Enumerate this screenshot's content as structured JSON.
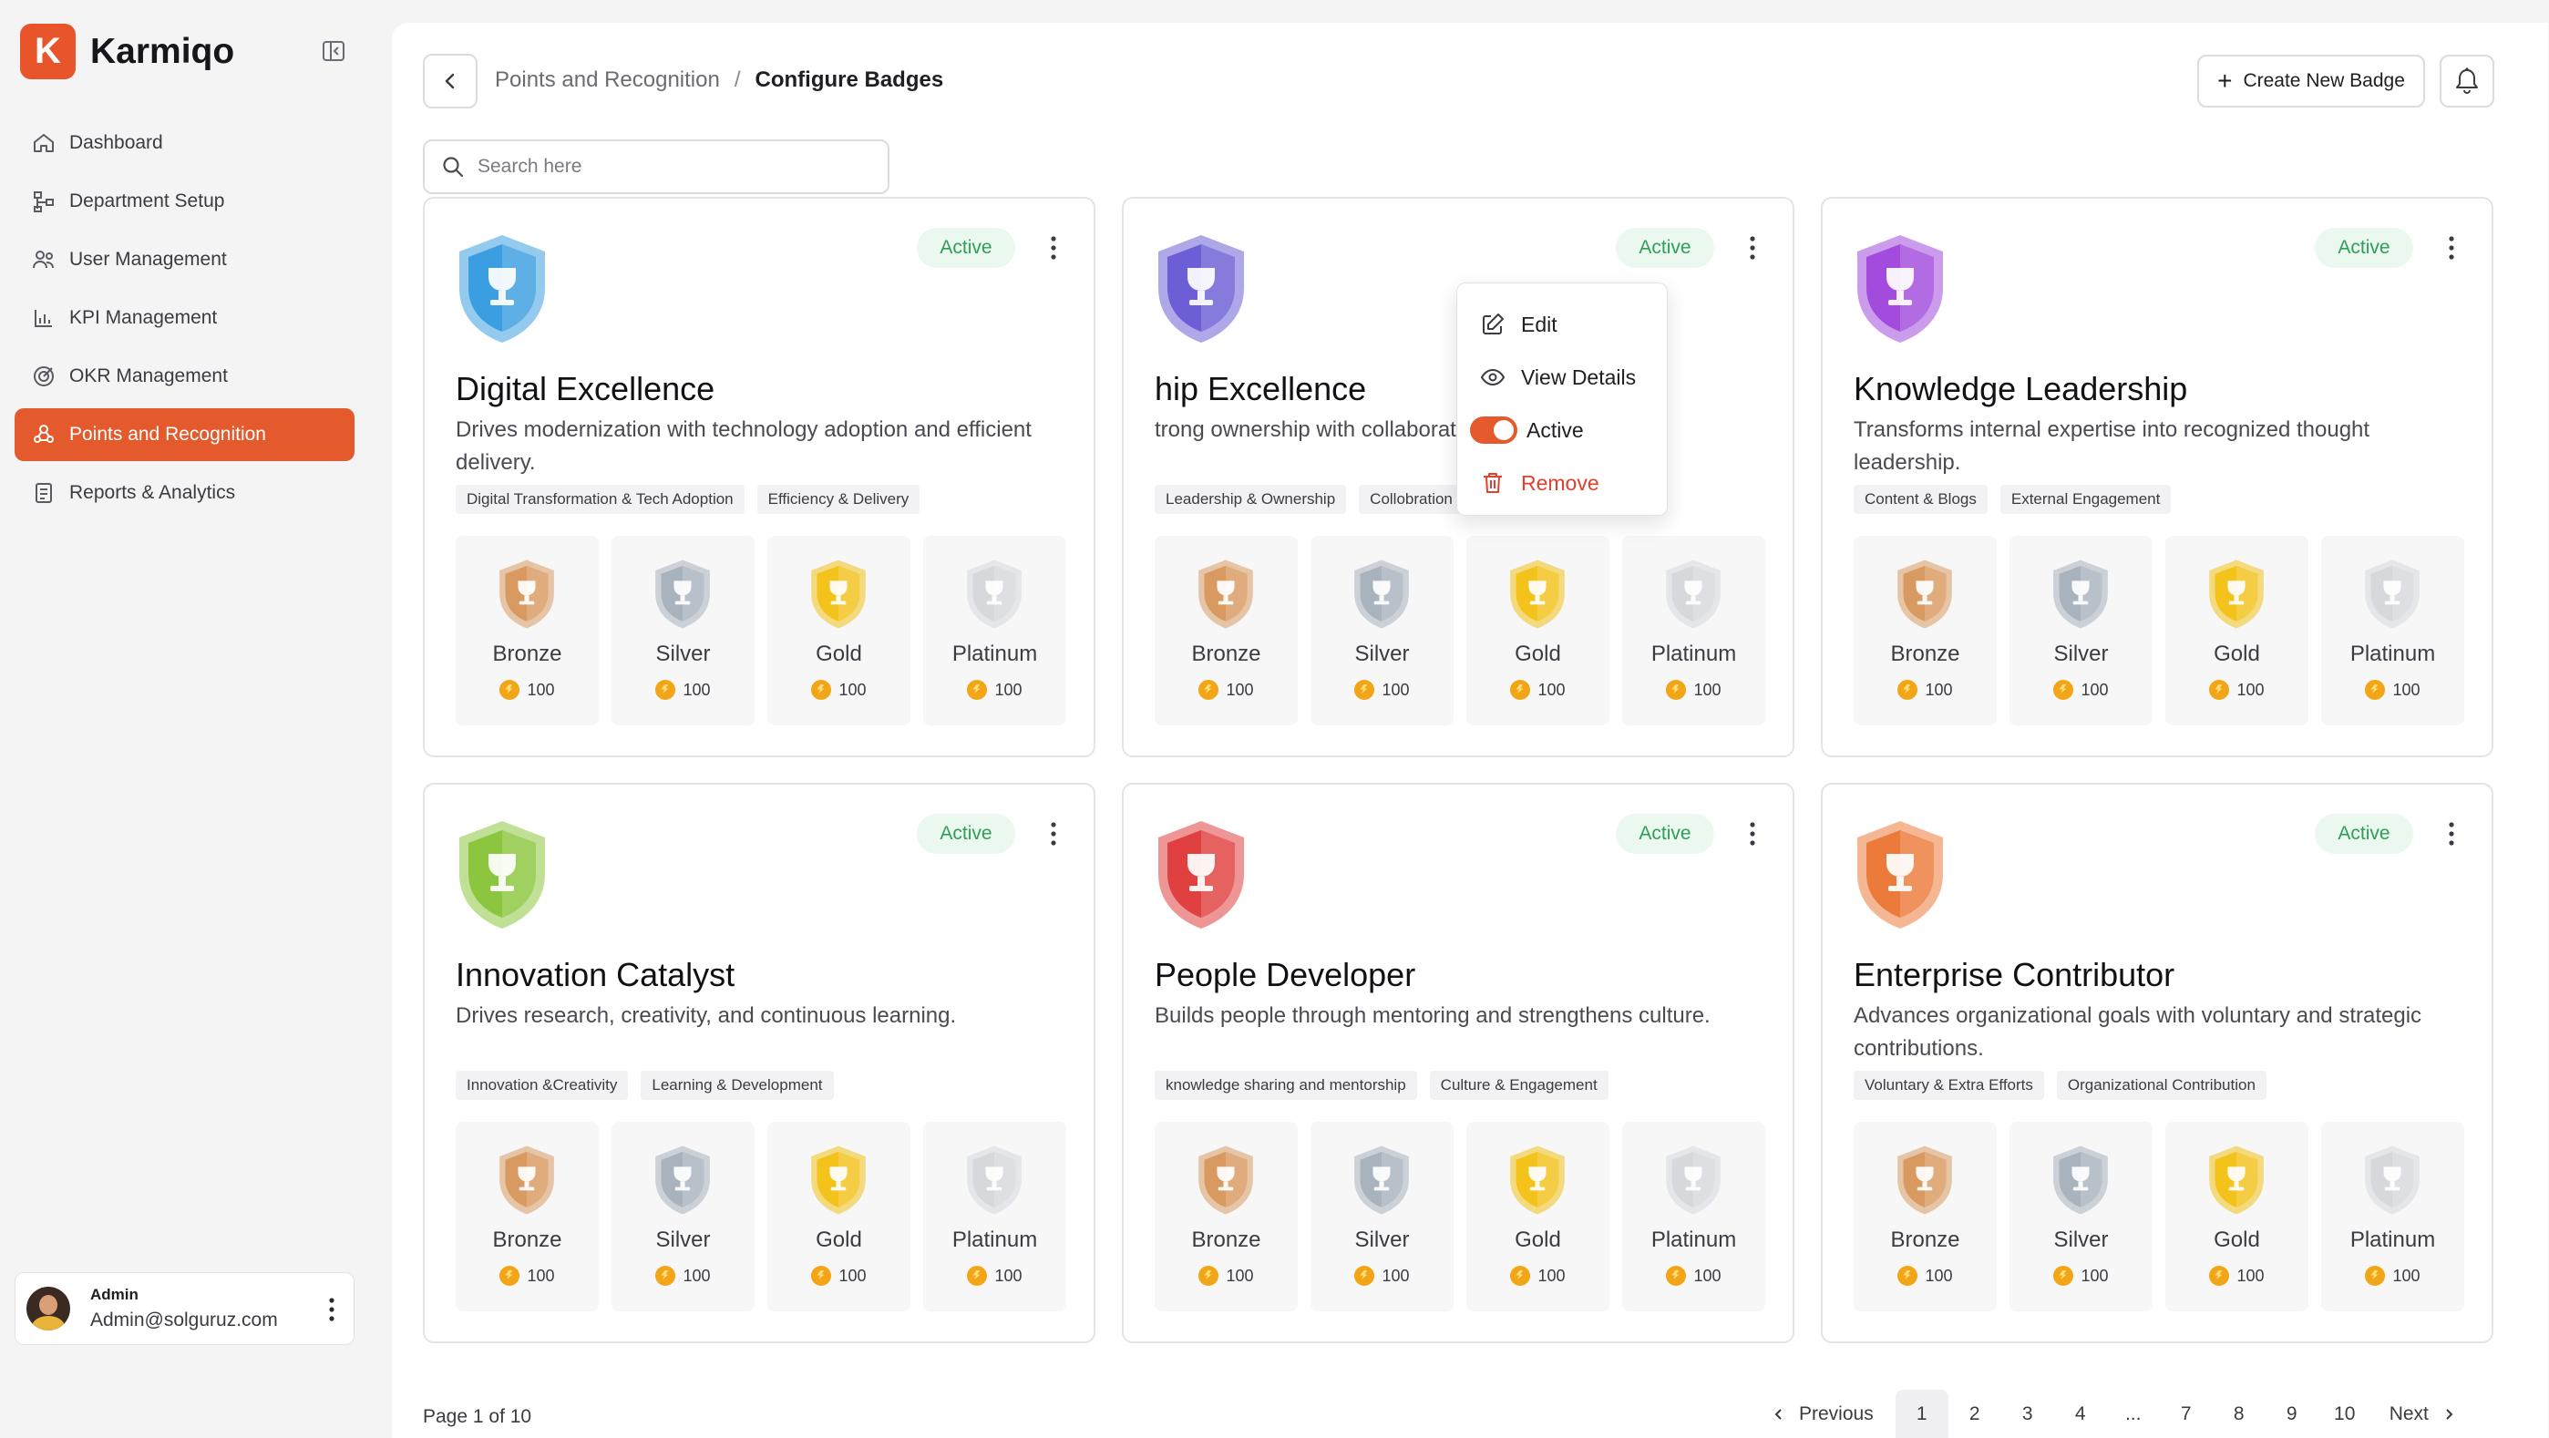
{
  "app": {
    "logo_letter": "K",
    "name": "Karmiqo"
  },
  "colors": {
    "accent": "#e55a2d",
    "active_green": "#2f9e57",
    "danger": "#e2402e"
  },
  "sidebar": {
    "items": [
      {
        "label": "Dashboard",
        "icon": "home-icon"
      },
      {
        "label": "Department Setup",
        "icon": "hierarchy-icon"
      },
      {
        "label": "User Management",
        "icon": "users-icon"
      },
      {
        "label": "KPI Management",
        "icon": "chart-icon"
      },
      {
        "label": "OKR Management",
        "icon": "target-icon"
      },
      {
        "label": "Points and Recognition",
        "icon": "award-icon",
        "active": true
      },
      {
        "label": "Reports & Analytics",
        "icon": "report-icon"
      }
    ],
    "user": {
      "name": "Admin",
      "email": "Admin@solguruz.com"
    }
  },
  "header": {
    "breadcrumb": [
      "Points and Recognition",
      "/",
      "Configure Badges"
    ],
    "create_label": "Create New Badge"
  },
  "search": {
    "placeholder": "Search here",
    "value": ""
  },
  "cards": [
    {
      "title": "Digital Excellence",
      "description": "Drives modernization with technology adoption and efficient delivery.",
      "status": "Active",
      "tags": [
        "Digital Transformation & Tech Adoption",
        "Efficiency & Delivery"
      ],
      "color": "#3b9ee0"
    },
    {
      "title": "Ownership Excellence",
      "title_visible": "hip Excellence",
      "description_visible": "trong ownership with collaborative team",
      "status": "Active",
      "tags": [
        "Leadership & Ownership",
        "Collobration and support"
      ],
      "color": "#6b5ed6"
    },
    {
      "title": "Knowledge Leadership",
      "description": "Transforms internal expertise into recognized thought leadership.",
      "status": "Active",
      "tags": [
        "Content & Blogs",
        "External Engagement"
      ],
      "color": "#a24bdc"
    },
    {
      "title": "Innovation Catalyst",
      "description": "Drives research, creativity, and continuous learning.",
      "status": "Active",
      "tags": [
        "Innovation &Creativity",
        "Learning & Development"
      ],
      "color": "#8cc63e"
    },
    {
      "title": "People Developer",
      "description": "Builds people through mentoring and strengthens culture.",
      "status": "Active",
      "tags": [
        "knowledge sharing and mentorship",
        "Culture & Engagement"
      ],
      "color": "#e0403f"
    },
    {
      "title": "Enterprise Contributor",
      "description": "Advances organizational goals with voluntary and strategic contributions.",
      "status": "Active",
      "tags": [
        "Voluntary & Extra Efforts",
        "Organizational Contribution"
      ],
      "color": "#ec7a3a"
    }
  ],
  "tiers": [
    {
      "name": "Bronze",
      "points": "100",
      "color": "#d99a62"
    },
    {
      "name": "Silver",
      "points": "100",
      "color": "#a9b3bd"
    },
    {
      "name": "Gold",
      "points": "100",
      "color": "#f3c21b"
    },
    {
      "name": "Platinum",
      "points": "100",
      "color": "#d6d8dc"
    }
  ],
  "menu": {
    "edit": "Edit",
    "view": "View Details",
    "toggle": "Active",
    "toggle_on": true,
    "remove": "Remove"
  },
  "pagination": {
    "info": "Page 1 of 10",
    "prev": "Previous",
    "next": "Next",
    "pages": [
      "1",
      "2",
      "3",
      "4",
      "...",
      "7",
      "8",
      "9",
      "10"
    ],
    "current": "1"
  }
}
